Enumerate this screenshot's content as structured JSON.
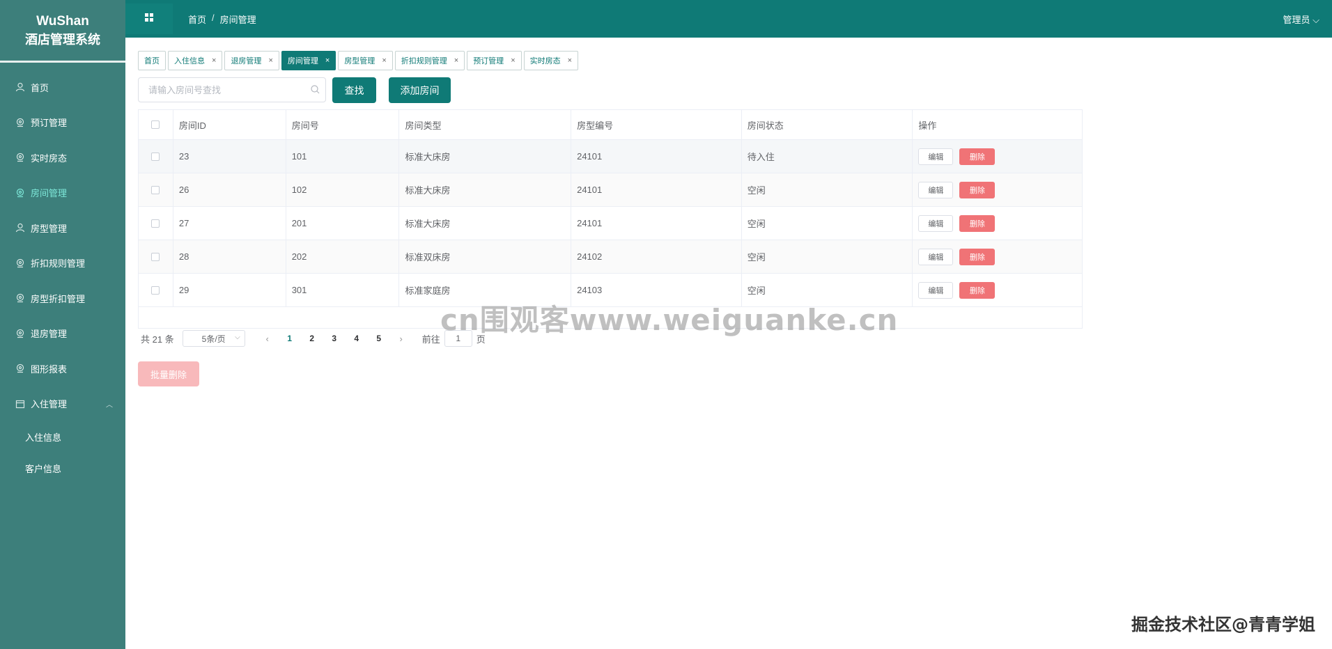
{
  "app": {
    "title_line1": "WuShan",
    "title_line2": "酒店管理系统"
  },
  "sidebar": {
    "items": [
      {
        "label": "首页",
        "icon": "user-icon",
        "active": false
      },
      {
        "label": "预订管理",
        "icon": "pin-icon",
        "active": false
      },
      {
        "label": "实时房态",
        "icon": "pin-icon",
        "active": false
      },
      {
        "label": "房间管理",
        "icon": "pin-icon",
        "active": true
      },
      {
        "label": "房型管理",
        "icon": "user-icon",
        "active": false
      },
      {
        "label": "折扣规则管理",
        "icon": "pin-icon",
        "active": false
      },
      {
        "label": "房型折扣管理",
        "icon": "pin-icon",
        "active": false
      },
      {
        "label": "退房管理",
        "icon": "pin-icon",
        "active": false
      },
      {
        "label": "图形报表",
        "icon": "pin-icon",
        "active": false
      },
      {
        "label": "入住管理",
        "icon": "calendar-icon",
        "active": false,
        "expanded": true
      }
    ],
    "subitems": [
      {
        "label": "入住信息"
      },
      {
        "label": "客户信息"
      }
    ]
  },
  "header": {
    "breadcrumb": [
      "首页",
      "房间管理"
    ],
    "breadcrumb_sep": "/",
    "user": "管理员"
  },
  "tags": [
    {
      "label": "首页",
      "closable": false,
      "active": false
    },
    {
      "label": "入住信息",
      "closable": true,
      "active": false
    },
    {
      "label": "退房管理",
      "closable": true,
      "active": false
    },
    {
      "label": "房间管理",
      "closable": true,
      "active": true
    },
    {
      "label": "房型管理",
      "closable": true,
      "active": false
    },
    {
      "label": "折扣规则管理",
      "closable": true,
      "active": false
    },
    {
      "label": "预订管理",
      "closable": true,
      "active": false
    },
    {
      "label": "实时房态",
      "closable": true,
      "active": false
    }
  ],
  "toolbar": {
    "search_placeholder": "请输入房间号查找",
    "search_label": "查找",
    "add_label": "添加房间"
  },
  "table": {
    "columns": [
      "房间ID",
      "房间号",
      "房间类型",
      "房型编号",
      "房间状态",
      "操作"
    ],
    "rows": [
      {
        "id": "23",
        "number": "101",
        "type": "标准大床房",
        "type_code": "24101",
        "status": "待入住"
      },
      {
        "id": "26",
        "number": "102",
        "type": "标准大床房",
        "type_code": "24101",
        "status": "空闲"
      },
      {
        "id": "27",
        "number": "201",
        "type": "标准大床房",
        "type_code": "24101",
        "status": "空闲"
      },
      {
        "id": "28",
        "number": "202",
        "type": "标准双床房",
        "type_code": "24102",
        "status": "空闲"
      },
      {
        "id": "29",
        "number": "301",
        "type": "标准家庭房",
        "type_code": "24103",
        "status": "空闲"
      }
    ],
    "edit_label": "编辑",
    "delete_label": "删除"
  },
  "pagination": {
    "total_text": "共 21 条",
    "page_size": "5条/页",
    "pages": [
      "1",
      "2",
      "3",
      "4",
      "5"
    ],
    "current": "1",
    "goto_prefix": "前往",
    "goto_value": "1",
    "goto_suffix": "页"
  },
  "batch_delete_label": "批量删除",
  "watermark": "cn围观客www.weiguanke.cn",
  "credit": "掘金技术社区@青青学姐",
  "colors": {
    "sidebar": "#3d7f7b",
    "topbar": "#0f7a76",
    "accent": "#0f7a76",
    "danger": "#f07376"
  }
}
